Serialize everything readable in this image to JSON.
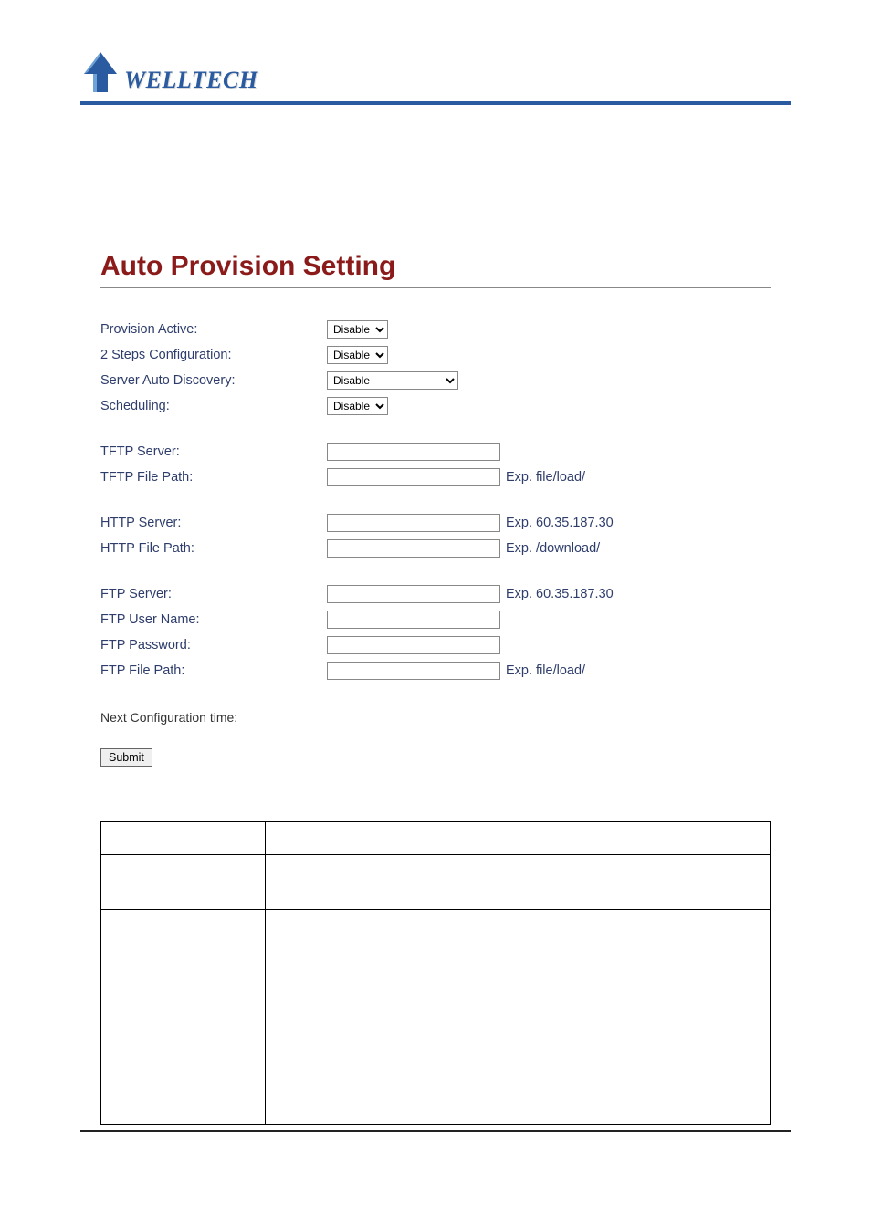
{
  "brand": "WELLTECH",
  "page": {
    "title": "Auto Provision Setting"
  },
  "form": {
    "provision_active": {
      "label": "Provision Active:",
      "value": "Disable"
    },
    "two_steps": {
      "label": "2 Steps Configuration:",
      "value": "Disable"
    },
    "auto_discovery": {
      "label": "Server Auto Discovery:",
      "value": "Disable"
    },
    "scheduling": {
      "label": "Scheduling:",
      "value": "Disable"
    },
    "tftp_server": {
      "label": "TFTP Server:",
      "value": ""
    },
    "tftp_path": {
      "label": "TFTP File Path:",
      "value": "",
      "hint": "Exp. file/load/"
    },
    "http_server": {
      "label": "HTTP Server:",
      "value": "",
      "hint": "Exp. 60.35.187.30"
    },
    "http_path": {
      "label": "HTTP File Path:",
      "value": "",
      "hint": "Exp. /download/"
    },
    "ftp_server": {
      "label": "FTP Server:",
      "value": "",
      "hint": "Exp. 60.35.187.30"
    },
    "ftp_user": {
      "label": "FTP User Name:",
      "value": ""
    },
    "ftp_pass": {
      "label": "FTP Password:",
      "value": ""
    },
    "ftp_path": {
      "label": "FTP File Path:",
      "value": "",
      "hint": "Exp. file/load/"
    },
    "next_config": {
      "label": "Next Configuration time:"
    },
    "submit": "Submit"
  }
}
